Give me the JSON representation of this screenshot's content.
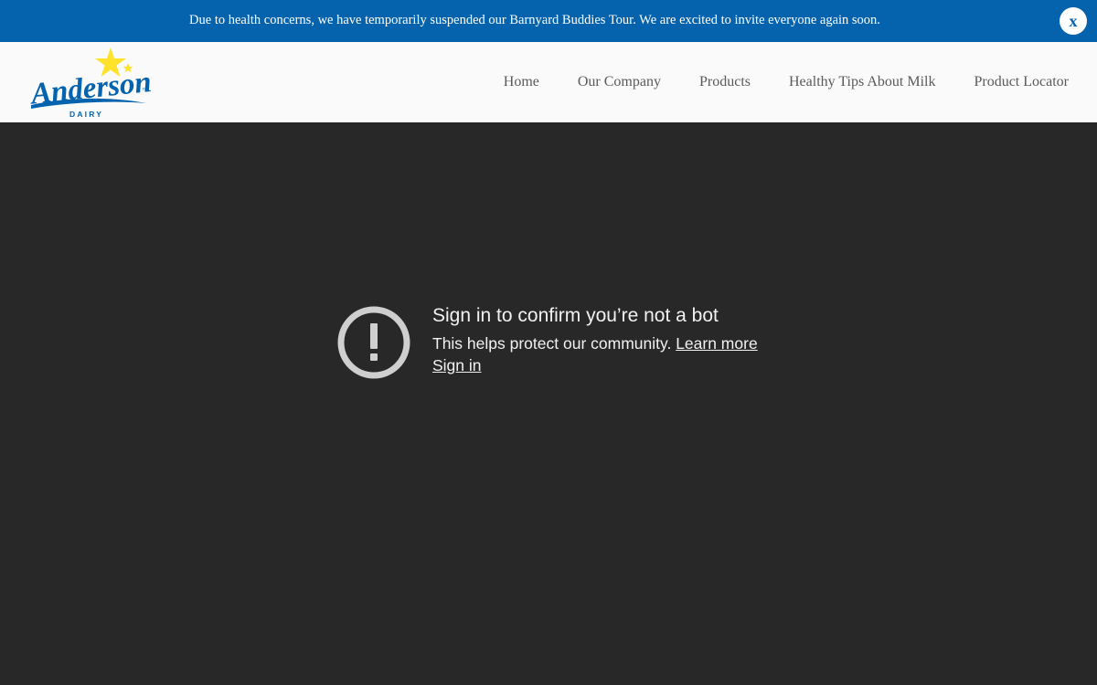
{
  "announcement": {
    "text": "Due to health concerns, we have temporarily suspended our Barnyard Buddies Tour. We are excited to invite everyone again soon.",
    "close_label": "x",
    "background": "#0563ae"
  },
  "header": {
    "logo": {
      "wordmark": "Anderson",
      "subtext": "DAIRY",
      "trademark": "™",
      "star_color": "#ffe229",
      "text_color": "#0563ae"
    },
    "nav": [
      {
        "label": "Home"
      },
      {
        "label": "Our Company"
      },
      {
        "label": "Products"
      },
      {
        "label": "Healthy Tips About Milk"
      },
      {
        "label": "Product Locator"
      }
    ]
  },
  "main": {
    "background": "#282828",
    "notice": {
      "icon": "alert-circle-icon",
      "title": "Sign in to confirm you’re not a bot",
      "body": "This helps protect our community.",
      "learn_more": "Learn more",
      "sign_in": "Sign in"
    }
  }
}
